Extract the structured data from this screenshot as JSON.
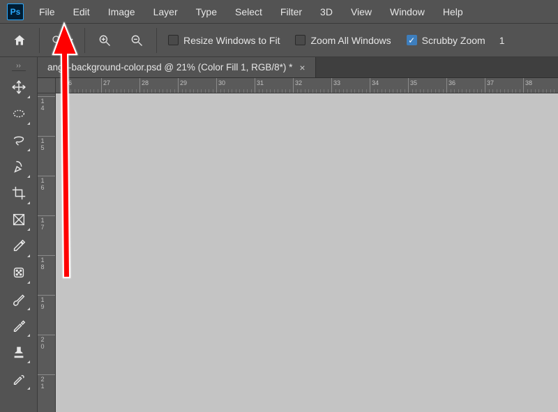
{
  "app": {
    "logo_text": "Ps"
  },
  "menu": [
    "File",
    "Edit",
    "Image",
    "Layer",
    "Type",
    "Select",
    "Filter",
    "3D",
    "View",
    "Window",
    "Help"
  ],
  "options": {
    "resize_windows": {
      "label": "Resize Windows to Fit",
      "checked": false
    },
    "zoom_all": {
      "label": "Zoom All Windows",
      "checked": false
    },
    "scrubby": {
      "label": "Scrubby Zoom",
      "checked": true
    },
    "trailing_value": "1"
  },
  "tools": [
    {
      "id": "move",
      "name": "move-tool-icon"
    },
    {
      "id": "marquee",
      "name": "marquee-tool-icon"
    },
    {
      "id": "lasso",
      "name": "lasso-tool-icon"
    },
    {
      "id": "quickselect",
      "name": "quick-select-tool-icon"
    },
    {
      "id": "crop",
      "name": "crop-tool-icon"
    },
    {
      "id": "frame",
      "name": "frame-tool-icon"
    },
    {
      "id": "eyedropper",
      "name": "eyedropper-tool-icon"
    },
    {
      "id": "healing",
      "name": "healing-brush-tool-icon"
    },
    {
      "id": "brush",
      "name": "brush-tool-icon"
    },
    {
      "id": "paintbrush",
      "name": "paintbrush-tool-icon"
    },
    {
      "id": "stamp",
      "name": "clone-stamp-tool-icon"
    },
    {
      "id": "history",
      "name": "history-brush-tool-icon"
    }
  ],
  "document": {
    "tab_title": "ange-background-color.psd @ 21% (Color Fill 1, RGB/8*) *"
  },
  "h_ruler_labels": [
    "26",
    "27",
    "28",
    "29",
    "30",
    "31",
    "32",
    "33",
    "34",
    "35",
    "36",
    "37",
    "38"
  ],
  "v_ruler_labels": [
    "14",
    "15",
    "16",
    "17",
    "18",
    "19",
    "20",
    "21"
  ]
}
